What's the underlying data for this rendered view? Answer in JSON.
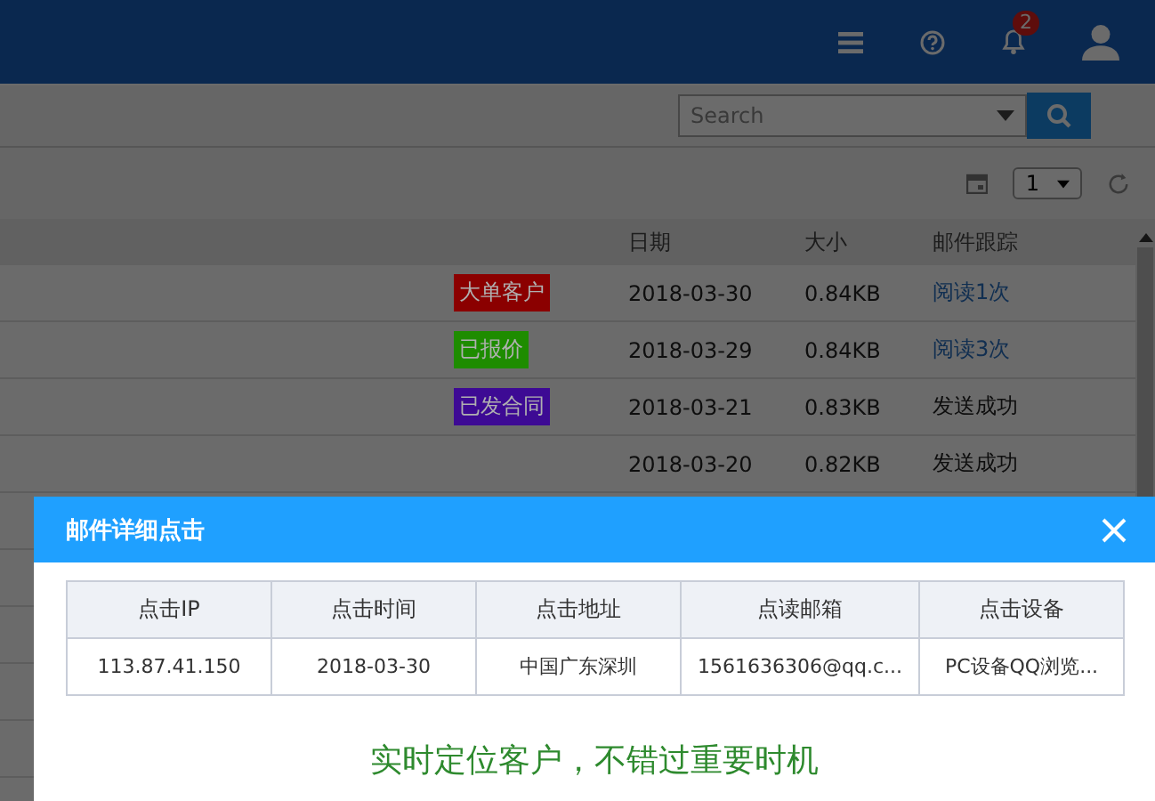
{
  "header": {
    "notification_count": "2"
  },
  "search": {
    "placeholder": "Search"
  },
  "pager": {
    "page": "1"
  },
  "mail_table": {
    "columns": [
      "日期",
      "大小",
      "邮件跟踪"
    ],
    "rows": [
      {
        "tag": {
          "text": "大单客户",
          "color": "#8b0000"
        },
        "date": "2018-03-30",
        "size": "0.84KB",
        "tracking": {
          "text": "阅读1次",
          "kind": "link"
        }
      },
      {
        "tag": {
          "text": "已报价",
          "color": "#1e8c00"
        },
        "date": "2018-03-29",
        "size": "0.84KB",
        "tracking": {
          "text": "阅读3次",
          "kind": "link"
        }
      },
      {
        "tag": {
          "text": "已发合同",
          "color": "#3d0a94"
        },
        "date": "2018-03-21",
        "size": "0.83KB",
        "tracking": {
          "text": "发送成功",
          "kind": "plain"
        }
      },
      {
        "date": "2018-03-20",
        "size": "0.82KB",
        "tracking": {
          "text": "发送成功",
          "kind": "plain"
        }
      }
    ]
  },
  "dialog": {
    "title": "邮件详细点击",
    "columns": [
      "点击IP",
      "点击时间",
      "点击地址",
      "点读邮箱",
      "点击设备"
    ],
    "rows": [
      [
        "113.87.41.150",
        "2018-03-30",
        "中国广东深圳",
        "1561636306@qq.c...",
        "PC设备QQ浏览..."
      ]
    ],
    "message": "实时定位客户，不错过重要时机"
  }
}
